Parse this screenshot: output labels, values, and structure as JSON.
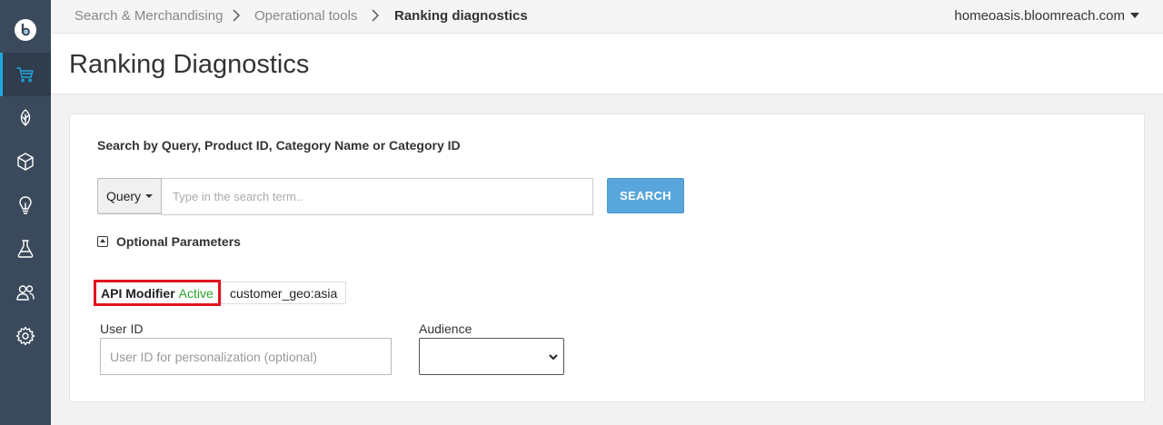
{
  "sidebar": {
    "items": [
      {
        "icon": "cart-icon",
        "active": true
      },
      {
        "icon": "leaf-icon",
        "active": false
      },
      {
        "icon": "cube-icon",
        "active": false
      },
      {
        "icon": "lightbulb-icon",
        "active": false
      },
      {
        "icon": "flask-icon",
        "active": false
      },
      {
        "icon": "users-icon",
        "active": false
      },
      {
        "icon": "gear-icon",
        "active": false
      }
    ],
    "accent_color": "#22a6dd",
    "background_color": "#3a4a5c"
  },
  "breadcrumb": {
    "items": [
      "Search & Merchandising",
      "Operational tools",
      "Ranking diagnostics"
    ]
  },
  "account": {
    "domain": "homeoasis.bloomreach.com"
  },
  "header": {
    "title": "Ranking Diagnostics"
  },
  "search": {
    "heading": "Search by Query, Product ID, Category Name or Category ID",
    "type_selected": "Query",
    "placeholder": "Type in the search term..",
    "value": "",
    "button_label": "SEARCH",
    "button_color": "#58a6dc"
  },
  "optional_parameters": {
    "label": "Optional Parameters",
    "expanded": true,
    "api_modifier": {
      "name": "API Modifier",
      "status": "Active",
      "status_color": "#2aa52a",
      "highlight_color": "#e0141e",
      "value": "customer_geo:asia"
    },
    "user_id": {
      "label": "User ID",
      "placeholder": "User ID for personalization (optional)",
      "value": ""
    },
    "audience": {
      "label": "Audience",
      "selected": ""
    }
  }
}
